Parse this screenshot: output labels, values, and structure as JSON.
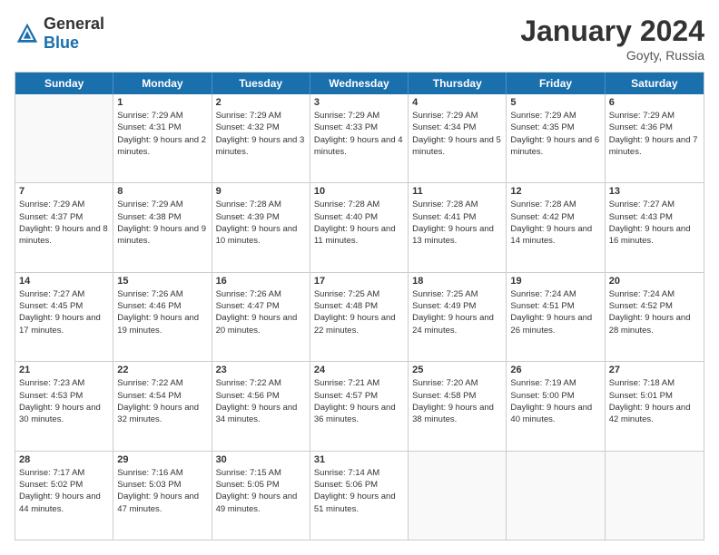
{
  "header": {
    "logo": {
      "general": "General",
      "blue": "Blue"
    },
    "title": "January 2024",
    "location": "Goyty, Russia"
  },
  "weekdays": [
    "Sunday",
    "Monday",
    "Tuesday",
    "Wednesday",
    "Thursday",
    "Friday",
    "Saturday"
  ],
  "weeks": [
    [
      {
        "day": "",
        "sunrise": "",
        "sunset": "",
        "daylight": ""
      },
      {
        "day": "1",
        "sunrise": "Sunrise: 7:29 AM",
        "sunset": "Sunset: 4:31 PM",
        "daylight": "Daylight: 9 hours and 2 minutes."
      },
      {
        "day": "2",
        "sunrise": "Sunrise: 7:29 AM",
        "sunset": "Sunset: 4:32 PM",
        "daylight": "Daylight: 9 hours and 3 minutes."
      },
      {
        "day": "3",
        "sunrise": "Sunrise: 7:29 AM",
        "sunset": "Sunset: 4:33 PM",
        "daylight": "Daylight: 9 hours and 4 minutes."
      },
      {
        "day": "4",
        "sunrise": "Sunrise: 7:29 AM",
        "sunset": "Sunset: 4:34 PM",
        "daylight": "Daylight: 9 hours and 5 minutes."
      },
      {
        "day": "5",
        "sunrise": "Sunrise: 7:29 AM",
        "sunset": "Sunset: 4:35 PM",
        "daylight": "Daylight: 9 hours and 6 minutes."
      },
      {
        "day": "6",
        "sunrise": "Sunrise: 7:29 AM",
        "sunset": "Sunset: 4:36 PM",
        "daylight": "Daylight: 9 hours and 7 minutes."
      }
    ],
    [
      {
        "day": "7",
        "sunrise": "Sunrise: 7:29 AM",
        "sunset": "Sunset: 4:37 PM",
        "daylight": "Daylight: 9 hours and 8 minutes."
      },
      {
        "day": "8",
        "sunrise": "Sunrise: 7:29 AM",
        "sunset": "Sunset: 4:38 PM",
        "daylight": "Daylight: 9 hours and 9 minutes."
      },
      {
        "day": "9",
        "sunrise": "Sunrise: 7:28 AM",
        "sunset": "Sunset: 4:39 PM",
        "daylight": "Daylight: 9 hours and 10 minutes."
      },
      {
        "day": "10",
        "sunrise": "Sunrise: 7:28 AM",
        "sunset": "Sunset: 4:40 PM",
        "daylight": "Daylight: 9 hours and 11 minutes."
      },
      {
        "day": "11",
        "sunrise": "Sunrise: 7:28 AM",
        "sunset": "Sunset: 4:41 PM",
        "daylight": "Daylight: 9 hours and 13 minutes."
      },
      {
        "day": "12",
        "sunrise": "Sunrise: 7:28 AM",
        "sunset": "Sunset: 4:42 PM",
        "daylight": "Daylight: 9 hours and 14 minutes."
      },
      {
        "day": "13",
        "sunrise": "Sunrise: 7:27 AM",
        "sunset": "Sunset: 4:43 PM",
        "daylight": "Daylight: 9 hours and 16 minutes."
      }
    ],
    [
      {
        "day": "14",
        "sunrise": "Sunrise: 7:27 AM",
        "sunset": "Sunset: 4:45 PM",
        "daylight": "Daylight: 9 hours and 17 minutes."
      },
      {
        "day": "15",
        "sunrise": "Sunrise: 7:26 AM",
        "sunset": "Sunset: 4:46 PM",
        "daylight": "Daylight: 9 hours and 19 minutes."
      },
      {
        "day": "16",
        "sunrise": "Sunrise: 7:26 AM",
        "sunset": "Sunset: 4:47 PM",
        "daylight": "Daylight: 9 hours and 20 minutes."
      },
      {
        "day": "17",
        "sunrise": "Sunrise: 7:25 AM",
        "sunset": "Sunset: 4:48 PM",
        "daylight": "Daylight: 9 hours and 22 minutes."
      },
      {
        "day": "18",
        "sunrise": "Sunrise: 7:25 AM",
        "sunset": "Sunset: 4:49 PM",
        "daylight": "Daylight: 9 hours and 24 minutes."
      },
      {
        "day": "19",
        "sunrise": "Sunrise: 7:24 AM",
        "sunset": "Sunset: 4:51 PM",
        "daylight": "Daylight: 9 hours and 26 minutes."
      },
      {
        "day": "20",
        "sunrise": "Sunrise: 7:24 AM",
        "sunset": "Sunset: 4:52 PM",
        "daylight": "Daylight: 9 hours and 28 minutes."
      }
    ],
    [
      {
        "day": "21",
        "sunrise": "Sunrise: 7:23 AM",
        "sunset": "Sunset: 4:53 PM",
        "daylight": "Daylight: 9 hours and 30 minutes."
      },
      {
        "day": "22",
        "sunrise": "Sunrise: 7:22 AM",
        "sunset": "Sunset: 4:54 PM",
        "daylight": "Daylight: 9 hours and 32 minutes."
      },
      {
        "day": "23",
        "sunrise": "Sunrise: 7:22 AM",
        "sunset": "Sunset: 4:56 PM",
        "daylight": "Daylight: 9 hours and 34 minutes."
      },
      {
        "day": "24",
        "sunrise": "Sunrise: 7:21 AM",
        "sunset": "Sunset: 4:57 PM",
        "daylight": "Daylight: 9 hours and 36 minutes."
      },
      {
        "day": "25",
        "sunrise": "Sunrise: 7:20 AM",
        "sunset": "Sunset: 4:58 PM",
        "daylight": "Daylight: 9 hours and 38 minutes."
      },
      {
        "day": "26",
        "sunrise": "Sunrise: 7:19 AM",
        "sunset": "Sunset: 5:00 PM",
        "daylight": "Daylight: 9 hours and 40 minutes."
      },
      {
        "day": "27",
        "sunrise": "Sunrise: 7:18 AM",
        "sunset": "Sunset: 5:01 PM",
        "daylight": "Daylight: 9 hours and 42 minutes."
      }
    ],
    [
      {
        "day": "28",
        "sunrise": "Sunrise: 7:17 AM",
        "sunset": "Sunset: 5:02 PM",
        "daylight": "Daylight: 9 hours and 44 minutes."
      },
      {
        "day": "29",
        "sunrise": "Sunrise: 7:16 AM",
        "sunset": "Sunset: 5:03 PM",
        "daylight": "Daylight: 9 hours and 47 minutes."
      },
      {
        "day": "30",
        "sunrise": "Sunrise: 7:15 AM",
        "sunset": "Sunset: 5:05 PM",
        "daylight": "Daylight: 9 hours and 49 minutes."
      },
      {
        "day": "31",
        "sunrise": "Sunrise: 7:14 AM",
        "sunset": "Sunset: 5:06 PM",
        "daylight": "Daylight: 9 hours and 51 minutes."
      },
      {
        "day": "",
        "sunrise": "",
        "sunset": "",
        "daylight": ""
      },
      {
        "day": "",
        "sunrise": "",
        "sunset": "",
        "daylight": ""
      },
      {
        "day": "",
        "sunrise": "",
        "sunset": "",
        "daylight": ""
      }
    ]
  ]
}
